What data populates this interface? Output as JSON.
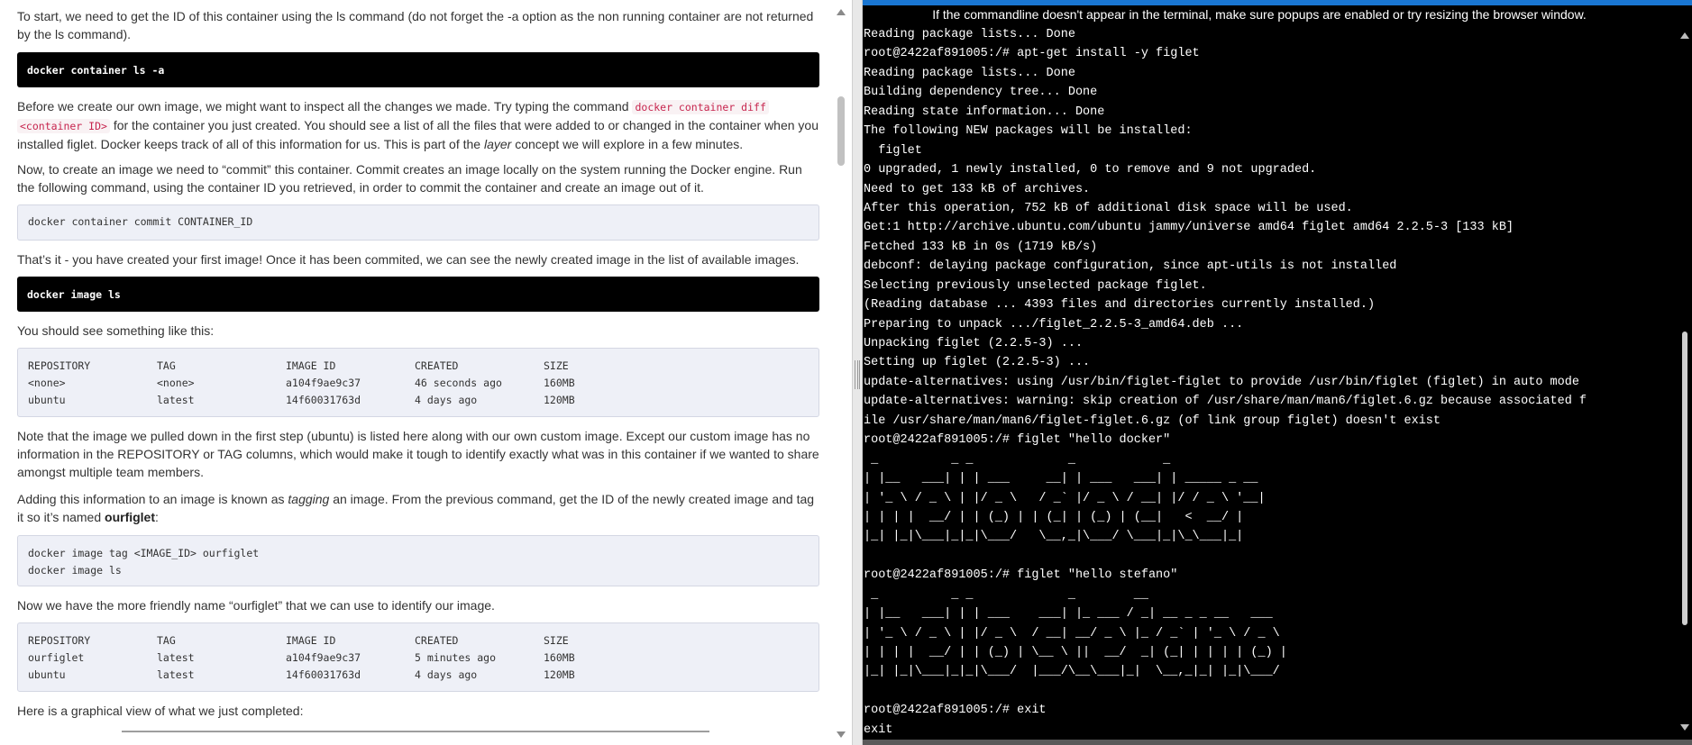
{
  "tutorial": {
    "intro_line1": "To start, we need to get the ID of this container using the ls command (do not forget the -a option as the non running container are not returned",
    "intro_line2": "by the ls command).",
    "cmd_ls_all": "docker container ls -a",
    "diff_text_before": "Before we create our own image, we might want to inspect all the changes we made. Try typing the command ",
    "diff_code_1": "docker container diff",
    "diff_code_2": "<container ID>",
    "diff_text_after": " for the container you just created. You should see a list of all the files that were added to or changed in the container when you installed figlet. Docker keeps track of all of this information for us. This is part of the ",
    "diff_em": "layer",
    "diff_text_end": " concept we will explore in a few minutes.",
    "commit_text": "Now, to create an image we need to “commit” this container. Commit creates an image locally on the system running the Docker engine. Run the following command, using the container ID you retrieved, in order to commit the container and create an image out of it.",
    "cmd_commit": "docker container commit CONTAINER_ID",
    "first_image_text": "That’s it - you have created your first image! Once it has been commited, we can see the newly created image in the list of available images.",
    "cmd_image_ls": "docker image ls",
    "see_something_text": "You should see something like this:",
    "table1": {
      "headers": [
        "REPOSITORY",
        "TAG",
        "IMAGE ID",
        "CREATED",
        "SIZE"
      ],
      "rows": [
        [
          "<none>",
          "<none>",
          "a104f9ae9c37",
          "46 seconds ago",
          "160MB"
        ],
        [
          "ubuntu",
          "latest",
          "14f60031763d",
          "4 days ago",
          "120MB"
        ]
      ]
    },
    "note_text": "Note that the image we pulled down in the first step (ubuntu) is listed here along with our own custom image. Except our custom image has no information in the REPOSITORY or TAG columns, which would make it tough to identify exactly what was in this container if we wanted to share amongst multiple team members.",
    "tag_text_before": "Adding this information to an image is known as ",
    "tag_em": "tagging",
    "tag_text_middle": " an image. From the previous command, get the ID of the newly created image and tag it so it’s named ",
    "tag_strong": "ourfiglet",
    "tag_text_end": ":",
    "cmd_tag_line1": "docker image tag <IMAGE_ID> ourfiglet",
    "cmd_tag_line2": "docker image ls",
    "friendly_text": "Now we have the more friendly name “ourfiglet” that we can use to identify our image.",
    "table2": {
      "headers": [
        "REPOSITORY",
        "TAG",
        "IMAGE ID",
        "CREATED",
        "SIZE"
      ],
      "rows": [
        [
          "ourfiglet",
          "latest",
          "a104f9ae9c37",
          "5 minutes ago",
          "160MB"
        ],
        [
          "ubuntu",
          "latest",
          "14f60031763d",
          "4 days ago",
          "120MB"
        ]
      ]
    },
    "graphical_text": "Here is a graphical view of what we just completed:"
  },
  "terminal": {
    "notice": "If the commandline doesn't appear in the terminal, make sure popups are enabled or try resizing the browser window.",
    "lines": [
      "Reading package lists... Done",
      "root@2422af891005:/# apt-get install -y figlet",
      "Reading package lists... Done",
      "Building dependency tree... Done",
      "Reading state information... Done",
      "The following NEW packages will be installed:",
      "  figlet",
      "0 upgraded, 1 newly installed, 0 to remove and 9 not upgraded.",
      "Need to get 133 kB of archives.",
      "After this operation, 752 kB of additional disk space will be used.",
      "Get:1 http://archive.ubuntu.com/ubuntu jammy/universe amd64 figlet amd64 2.2.5-3 [133 kB]",
      "Fetched 133 kB in 0s (1719 kB/s)",
      "debconf: delaying package configuration, since apt-utils is not installed",
      "Selecting previously unselected package figlet.",
      "(Reading database ... 4393 files and directories currently installed.)",
      "Preparing to unpack .../figlet_2.2.5-3_amd64.deb ...",
      "Unpacking figlet (2.2.5-3) ...",
      "Setting up figlet (2.2.5-3) ...",
      "update-alternatives: using /usr/bin/figlet-figlet to provide /usr/bin/figlet (figlet) in auto mode",
      "update-alternatives: warning: skip creation of /usr/share/man/man6/figlet.6.gz because associated f",
      "ile /usr/share/man/man6/figlet-figlet.6.gz (of link group figlet) doesn't exist",
      "root@2422af891005:/# figlet \"hello docker\"",
      " _          _ _             _            _",
      "| |__   ___| | | ___     __| | ___   ___| | _____ _ __",
      "| '_ \\ / _ \\ | |/ _ \\   / _` |/ _ \\ / __| |/ / _ \\ '__|",
      "| | | |  __/ | | (_) | | (_| | (_) | (__|   <  __/ |",
      "|_| |_|\\___|_|_|\\___/   \\__,_|\\___/ \\___|_|\\_\\___|_|",
      "",
      "root@2422af891005:/# figlet \"hello stefano\"",
      " _          _ _             _        __",
      "| |__   ___| | | ___    ___| |_ ___ / _| __ _ _ __   ___",
      "| '_ \\ / _ \\ | |/ _ \\  / __| __/ _ \\ |_ / _` | '_ \\ / _ \\",
      "| | | |  __/ | | (_) | \\__ \\ ||  __/  _| (_| | | | | (_) |",
      "|_| |_|\\___|_|_|\\___/  |___/\\__\\___|_|  \\__,_|_| |_|\\___/",
      "",
      "root@2422af891005:/# exit",
      "exit"
    ]
  },
  "colors": {
    "terminal_bg": "#000000",
    "terminal_accent": "#1976d2",
    "dark_cmd_bg": "#000000",
    "light_code_bg": "#eef0f7",
    "inline_code": "#c7254e"
  }
}
